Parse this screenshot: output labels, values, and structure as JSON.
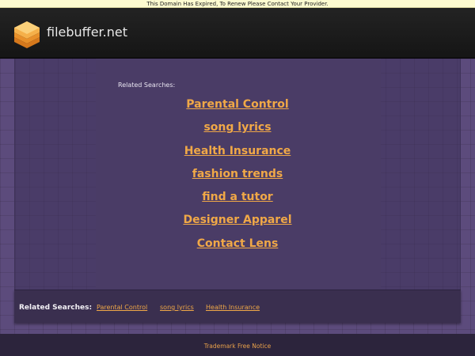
{
  "notice": {
    "text": "This Domain Has Expired, To Renew Please Contact Your Provider."
  },
  "header": {
    "site_name": "filebuffer.net",
    "logo_icon": "stacked-layers-icon"
  },
  "main": {
    "related_label": "Related Searches:",
    "links": [
      "Parental Control",
      "song lyrics",
      "Health Insurance",
      "fashion trends",
      "find a tutor",
      "Designer Apparel",
      "Contact Lens"
    ]
  },
  "footer_related": {
    "label": "Related Searches:",
    "links": [
      "Parental Control",
      "song lyrics",
      "Health Insurance"
    ]
  },
  "bottom": {
    "trademark": "Trademark Free Notice"
  },
  "colors": {
    "accent": "#f0a847",
    "background": "#5b4a7a",
    "header": "#1c1c1c"
  }
}
